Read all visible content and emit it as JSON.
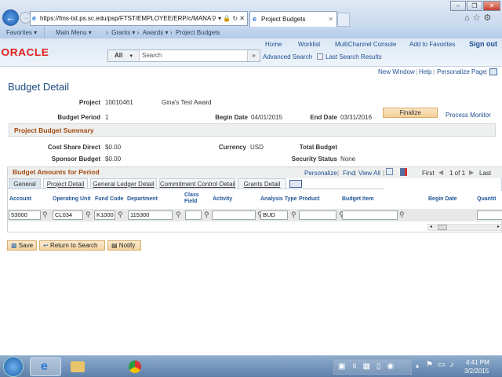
{
  "browser": {
    "url": "https://fms-tst.ps.sc.edu/psp/FTST/EMPLOYEE/ERP/c/MANA",
    "tab_title": "Project Budgets"
  },
  "favbar": {
    "favorites": "Favorites",
    "main_menu": "Main Menu",
    "crumbs": [
      "Grants",
      "Awards",
      "Project Budgets"
    ]
  },
  "header": {
    "links": [
      "Home",
      "Worklist",
      "MultiChannel Console",
      "Add to Favorites",
      "Sign out"
    ],
    "logo": "ORACLE",
    "search_scope": "All",
    "search_placeholder": "Search",
    "advanced_search": "Advanced Search",
    "last_results": "Last Search Results"
  },
  "toplinks": [
    "New Window",
    "Help",
    "Personalize Page"
  ],
  "page": {
    "title": "Budget Detail",
    "project_label": "Project",
    "project": "10010461",
    "project_desc": "Gina's Test Award",
    "period_label": "Budget Period",
    "period": "1",
    "begin_label": "Begin Date",
    "begin": "04/01/2015",
    "end_label": "End Date",
    "end": "03/31/2016",
    "finalize": "Finalize",
    "process_monitor": "Process Monitor"
  },
  "summary": {
    "title": "Project Budget Summary",
    "cost_share_label": "Cost Share Direct",
    "cost_share": "$0.00",
    "currency_label": "Currency",
    "currency": "USD",
    "total_label": "Total Budget",
    "sponsor_label": "Sponsor Budget",
    "sponsor": "$0.00",
    "security_label": "Security Status",
    "security": "None"
  },
  "grid": {
    "title": "Budget Amounts for Period",
    "personalize": "Personalize",
    "find": "Find",
    "view_all": "View All",
    "first": "First",
    "pager": "1 of 1",
    "last": "Last",
    "tabs": [
      "General",
      "Project Detail",
      "General Ledger Detail",
      "Commitment Control Detail",
      "Grants Detail"
    ],
    "columns": [
      "Account",
      "Operating Unit",
      "Fund Code",
      "Department",
      "Class Field",
      "Activity",
      "Analysis Type",
      "Product",
      "Budget Item",
      "Begin Date",
      "Quantit"
    ],
    "row": {
      "account": "53000",
      "operating_unit": "CL034",
      "fund_code": "K1000",
      "department": "115300",
      "class_field": "",
      "activity": "",
      "analysis_type": "BUD",
      "product": "",
      "budget_item": "",
      "quantity": ""
    }
  },
  "buttons": {
    "save": "Save",
    "return": "Return to Search",
    "notify": "Notify"
  },
  "taskbar": {
    "time": "4:41 PM",
    "date": "3/2/2015"
  }
}
